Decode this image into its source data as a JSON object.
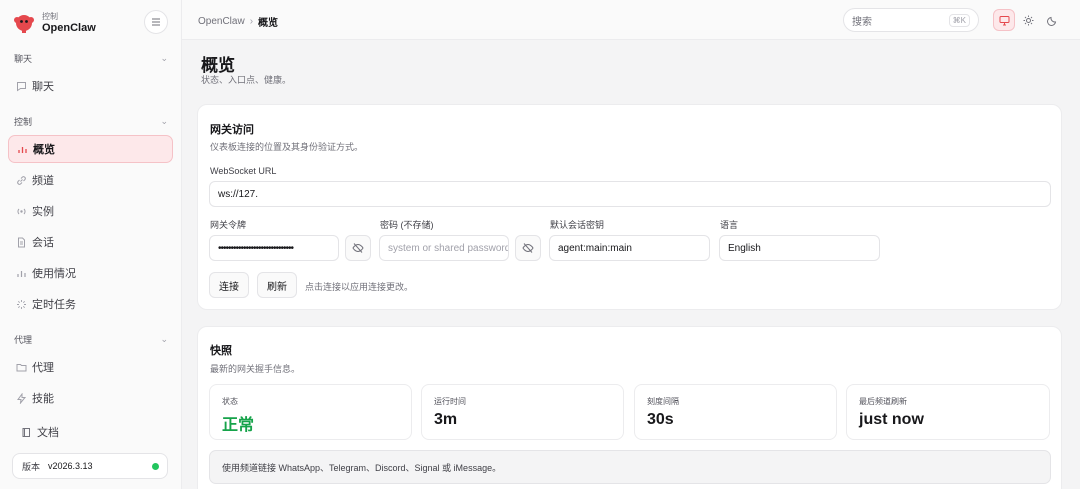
{
  "brand": {
    "subtitle": "控制",
    "name": "OpenClaw"
  },
  "sidebar": {
    "sections": [
      {
        "label": "聊天"
      },
      {
        "label": "控制"
      },
      {
        "label": "代理"
      }
    ],
    "items": [
      {
        "label": "聊天",
        "icon": "message-icon"
      },
      {
        "label": "概览",
        "icon": "bar-chart-icon",
        "active": true
      },
      {
        "label": "频道",
        "icon": "link-icon"
      },
      {
        "label": "实例",
        "icon": "radio-icon"
      },
      {
        "label": "会话",
        "icon": "file-icon"
      },
      {
        "label": "使用情况",
        "icon": "bar-chart-icon"
      },
      {
        "label": "定时任务",
        "icon": "loader-icon"
      },
      {
        "label": "代理",
        "icon": "folder-icon"
      },
      {
        "label": "技能",
        "icon": "zap-icon"
      }
    ],
    "docs_label": "文档",
    "version": {
      "label": "版本",
      "value": "v2026.3.13",
      "status_color": "#22c55e"
    }
  },
  "topbar": {
    "breadcrumb": {
      "root": "OpenClaw",
      "separator": "›",
      "current": "概览"
    },
    "search": {
      "placeholder": "搜索",
      "shortcut": "⌘K"
    },
    "theme_modes": [
      "monitor-icon",
      "sun-icon",
      "moon-icon"
    ]
  },
  "page": {
    "title": "概览",
    "subtitle": "状态、入口点、健康。"
  },
  "gateway": {
    "title": "网关访问",
    "subtitle": "仪表板连接的位置及其身份验证方式。",
    "ws_label": "WebSocket URL",
    "ws_value": "ws://127.",
    "token_label": "网关令牌",
    "token_value": "••••••••••••••••••••••••••••••",
    "password_label": "密码 (不存储)",
    "password_placeholder": "system or shared password",
    "session_label": "默认会话密钥",
    "session_value": "agent:main:main",
    "language_label": "语言",
    "language_value": "English",
    "connect_label": "连接",
    "refresh_label": "刷新",
    "hint": "点击连接以应用连接更改。"
  },
  "snapshot": {
    "title": "快照",
    "subtitle": "最新的网关握手信息。",
    "stats": [
      {
        "label": "状态",
        "value": "正常"
      },
      {
        "label": "运行时间",
        "value": "3m"
      },
      {
        "label": "刻度间隔",
        "value": "30s"
      },
      {
        "label": "最后频道刷新",
        "value": "just now"
      }
    ],
    "notice": "使用频道链接 WhatsApp、Telegram、Discord、Signal 或 iMessage。"
  },
  "colors": {
    "accent": "#e5484d",
    "ok": "#16a34a"
  }
}
